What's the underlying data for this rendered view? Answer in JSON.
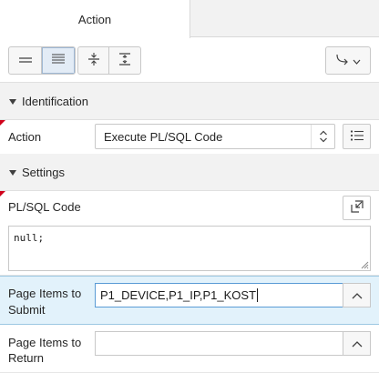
{
  "tabs": {
    "action_label": "Action"
  },
  "toolbar": {
    "icons": [
      "show-common-icon",
      "show-all-icon",
      "collapse-all-icon",
      "expand-all-icon",
      "go-to-group-icon"
    ]
  },
  "sections": {
    "identification": "Identification",
    "settings": "Settings"
  },
  "identification": {
    "action_label": "Action",
    "action_value": "Execute PL/SQL Code"
  },
  "settings": {
    "plsql_label": "PL/SQL Code",
    "plsql_value": "null;",
    "items_submit_label_1": "Page Items to",
    "items_submit_label_2": "Submit",
    "items_submit_value": "P1_DEVICE,P1_IP,P1_KOST",
    "items_return_label_1": "Page Items to",
    "items_return_label_2": "Return",
    "items_return_value": ""
  },
  "colors": {
    "required_marker": "#d0021b",
    "highlight_row": "#e2f2fb",
    "focus_border": "#5a9bd5"
  }
}
